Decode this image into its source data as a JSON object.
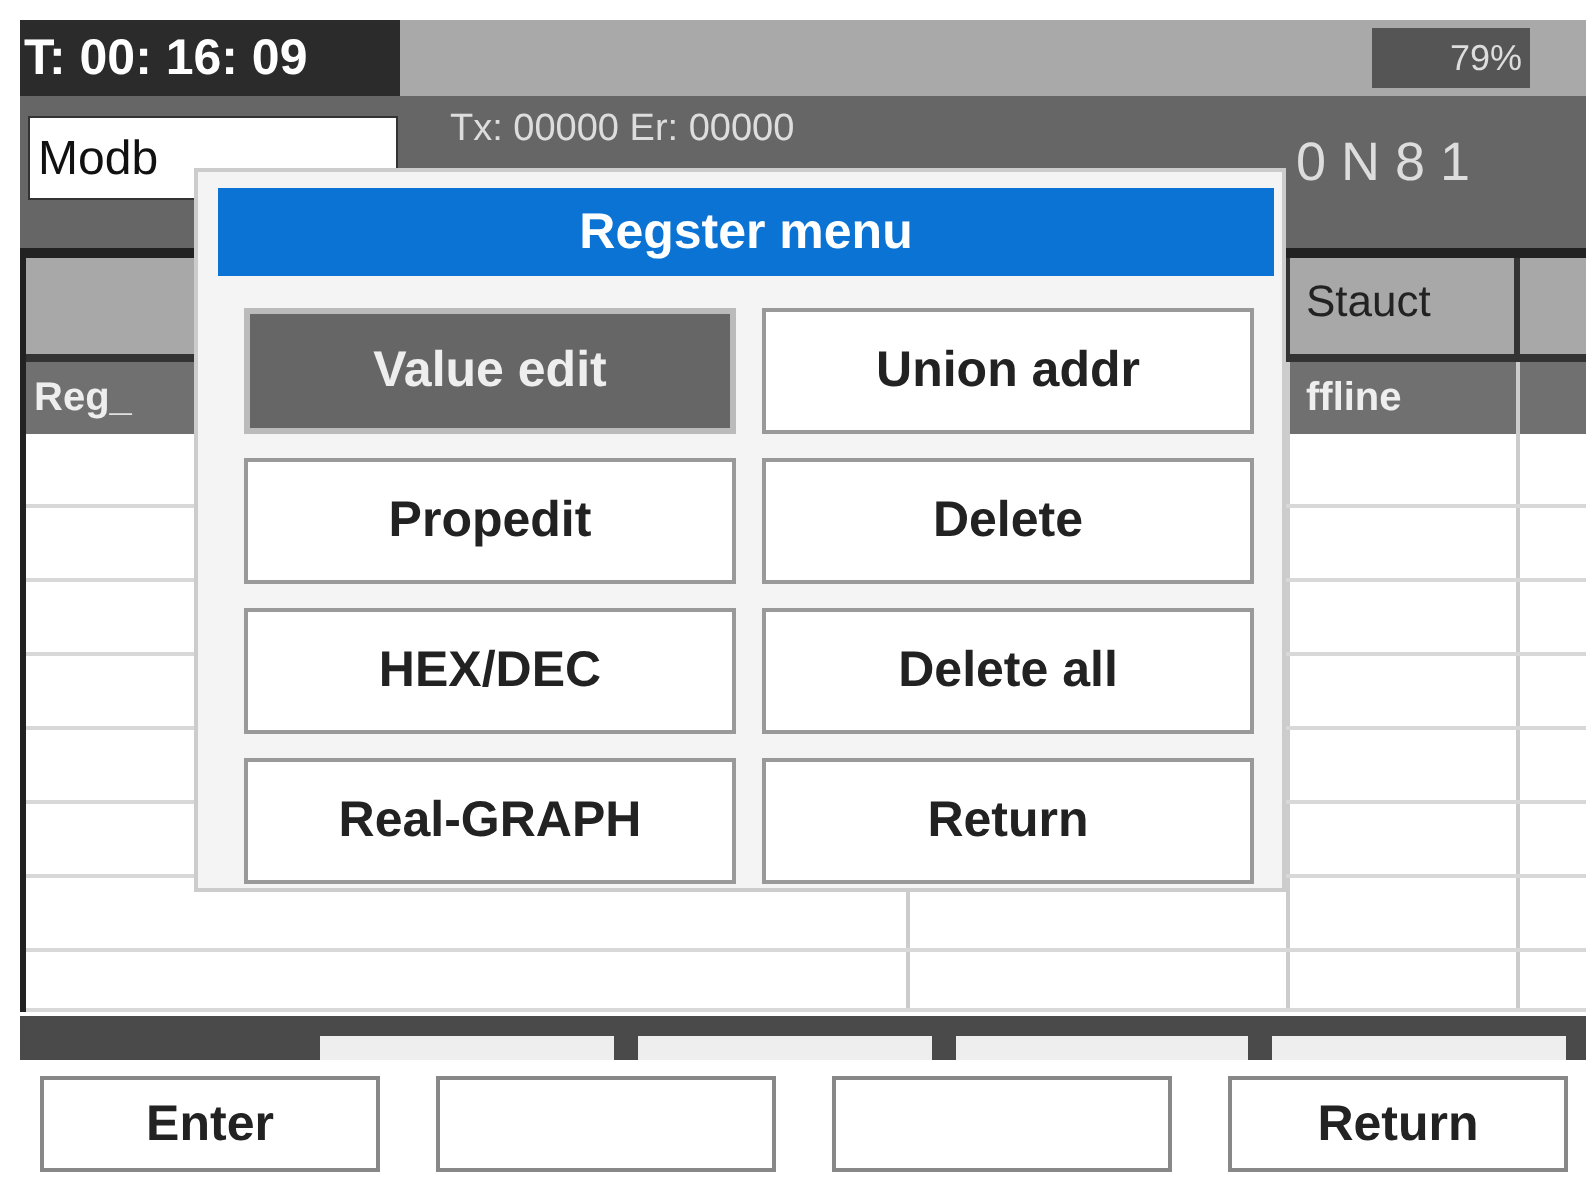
{
  "status_bar": {
    "time": "T: 00: 16: 09",
    "battery": "79%"
  },
  "connection": {
    "protocol": "Modb",
    "counters": "Tx: 00000 Er: 00000",
    "serial": "0 N 8 1"
  },
  "table": {
    "column_3": "Stauct",
    "rows": [
      {
        "column_1": "Reg_",
        "column_3": "ffline",
        "selected": true
      }
    ]
  },
  "dialog": {
    "title": "Regster menu",
    "items": [
      {
        "label": "Value edit",
        "selected": true
      },
      {
        "label": "Union addr",
        "selected": false
      },
      {
        "label": "Propedit",
        "selected": false
      },
      {
        "label": "Delete",
        "selected": false
      },
      {
        "label": "HEX/DEC",
        "selected": false
      },
      {
        "label": "Delete all",
        "selected": false
      },
      {
        "label": "Real-GRAPH",
        "selected": false
      },
      {
        "label": "Return",
        "selected": false
      }
    ]
  },
  "softkeys": [
    {
      "kind": "label",
      "label": "Enter"
    },
    {
      "kind": "blank"
    },
    {
      "kind": "blank"
    },
    {
      "kind": "label",
      "label": "Return"
    }
  ]
}
